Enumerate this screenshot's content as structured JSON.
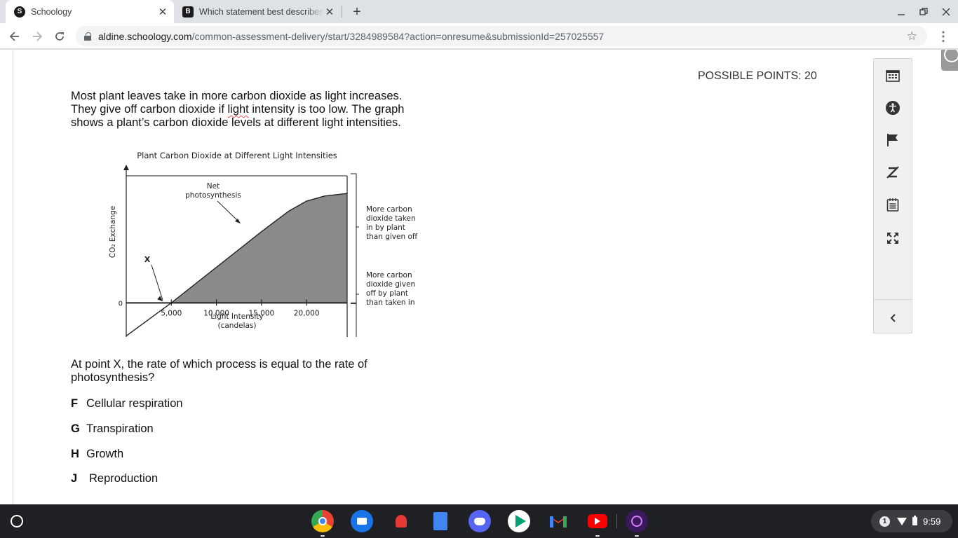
{
  "browser": {
    "tabs": [
      {
        "title": "Schoology",
        "favicon": "S"
      },
      {
        "title": "Which statement best describes",
        "favicon": "B"
      }
    ],
    "new_tab": "+",
    "close_glyph": "✕",
    "url_host": "aldine.schoology.com",
    "url_path": "/common-assessment-delivery/start/3284989584?action=onresume&submissionId=257025557"
  },
  "assessment": {
    "possible_points": "POSSIBLE POINTS: 20",
    "passage_line1": "Most plant leaves take in more carbon dioxide as light increases.",
    "passage_line2a": "They give off carbon dioxide if ",
    "passage_line2b": "light",
    "passage_line2c": " intensity is too low.  The graph",
    "passage_line3": "shows a plant’s carbon dioxide levels at different light intensities.",
    "prompt": "At point X, the rate of which process is equal to the rate of photosynthesis?",
    "answers": [
      {
        "letter": "F",
        "text": "Cellular respiration"
      },
      {
        "letter": "G",
        "text": "Transpiration"
      },
      {
        "letter": "H",
        "text": "Growth"
      },
      {
        "letter": "J",
        "text": "Reproduction"
      }
    ]
  },
  "chart_data": {
    "type": "area",
    "title": "Plant Carbon Dioxide at Different Light Intensities",
    "xlabel": "Light Intensity",
    "xlabel_unit": "(candelas)",
    "ylabel": "CO₂ Exchange",
    "y_zero_label": "0",
    "x_ticks": [
      5000,
      10000,
      15000,
      20000
    ],
    "x_tick_labels": [
      "5,000",
      "10,000",
      "15,000",
      "20,000"
    ],
    "xlim": [
      0,
      24500
    ],
    "ylim": [
      -1,
      2.4
    ],
    "series": [
      {
        "values_x": [
          0,
          5000,
          10000,
          15000,
          18000,
          20000,
          22000,
          24500
        ],
        "values_y": [
          -0.65,
          0,
          0.7,
          1.4,
          1.8,
          2.0,
          2.1,
          2.15
        ]
      }
    ],
    "annotations": {
      "net": "Net",
      "photosynthesis": "photosynthesis",
      "point": "X",
      "above_bracket": [
        "More carbon",
        "dioxide taken",
        "in by plant",
        "than given off"
      ],
      "below_bracket": [
        "More carbon",
        "dioxide given",
        "off by plant",
        "than taken in"
      ]
    },
    "fill_color": "#8a8a8a",
    "grid": false
  },
  "taskbar": {
    "notification_count": "1",
    "time": "9:59"
  }
}
